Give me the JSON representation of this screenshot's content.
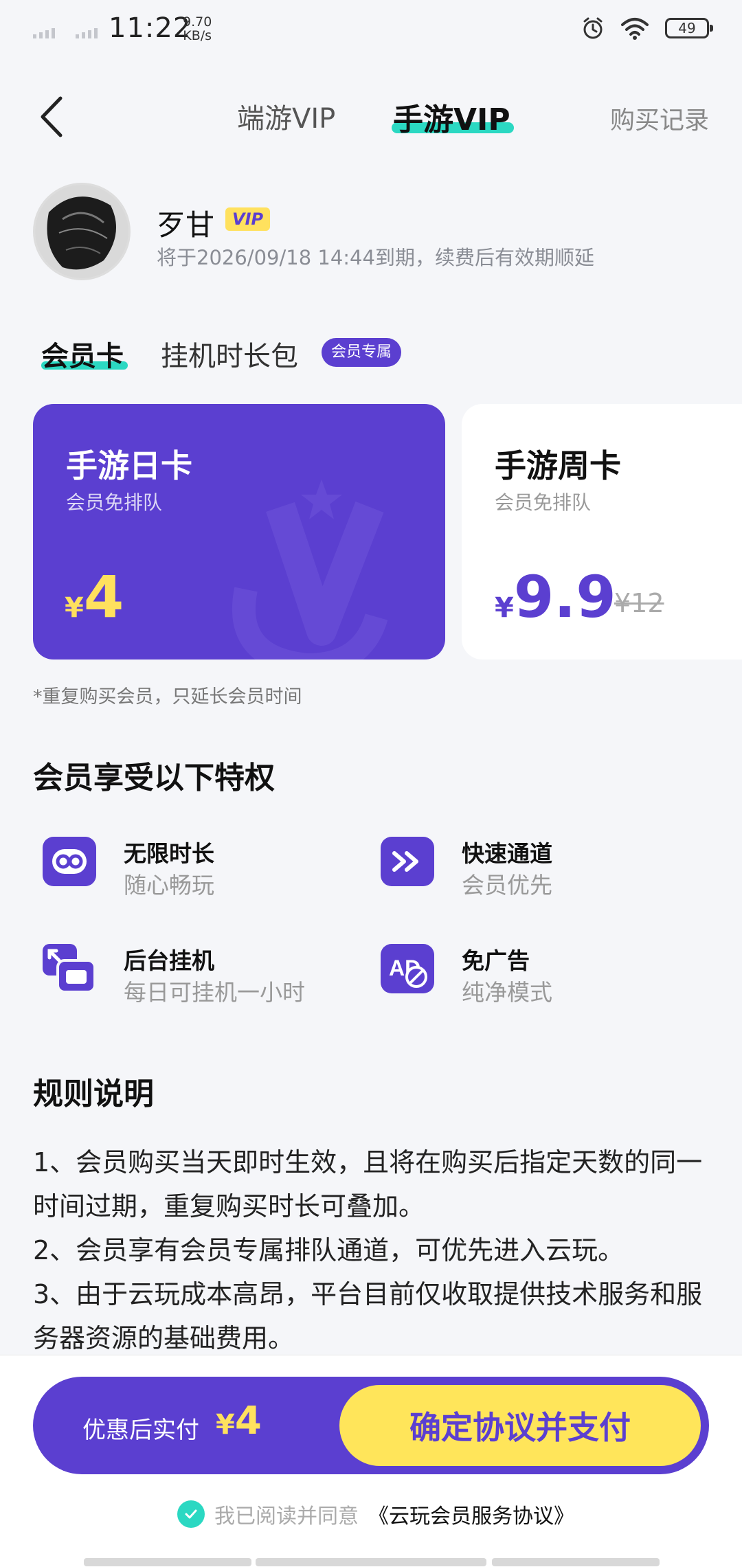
{
  "status_bar": {
    "time": "11:22",
    "net_speed_value": "9.70",
    "net_speed_unit": "KB/s",
    "battery": "49"
  },
  "nav": {
    "tab_pc": "端游VIP",
    "tab_mobile": "手游VIP",
    "purchase_record": "购买记录"
  },
  "profile": {
    "username": "歹甘",
    "vip_badge": "VIP",
    "expire_text": "将于2026/09/18 14:44到期，续费后有效期顺延"
  },
  "categories": {
    "member_card": "会员卡",
    "hangup_pack": "挂机时长包",
    "member_only_badge": "会员专属"
  },
  "plans": [
    {
      "title": "手游日卡",
      "subtitle": "会员免排队",
      "currency": "¥",
      "price": "4",
      "selected": true
    },
    {
      "title": "手游周卡",
      "subtitle": "会员免排队",
      "currency": "¥",
      "price": "9.9",
      "original_price": "¥12",
      "selected": false
    }
  ],
  "note": "*重复购买会员，只延长会员时间",
  "privileges": {
    "heading": "会员享受以下特权",
    "items": [
      {
        "title": "无限时长",
        "desc": "随心畅玩",
        "icon": "infinity-icon"
      },
      {
        "title": "快速通道",
        "desc": "会员优先",
        "icon": "fast-forward-icon"
      },
      {
        "title": "后台挂机",
        "desc": "每日可挂机一小时",
        "icon": "background-window-icon"
      },
      {
        "title": "免广告",
        "desc": "纯净模式",
        "icon": "no-ads-icon"
      }
    ]
  },
  "rules": {
    "heading": "规则说明",
    "lines": [
      "1、会员购买当天即时生效，且将在购买后指定天数的同一时间过期，重复购买时长可叠加。",
      "2、会员享有会员专属排队通道，可优先进入云玩。",
      "3、由于云玩成本高昂，平台目前仅收取提供技术服务和服务器资源的基础费用。"
    ]
  },
  "payment": {
    "label": "优惠后实付",
    "currency": "¥",
    "amount": "4",
    "button": "确定协议并支付",
    "agree_prefix": "我已阅读并同意",
    "agree_link": "《云玩会员服务协议》"
  },
  "colors": {
    "primary": "#5b3fd0",
    "accent_teal": "#2bd8c2",
    "accent_yellow": "#ffe15e",
    "background": "#f5f6f9"
  }
}
